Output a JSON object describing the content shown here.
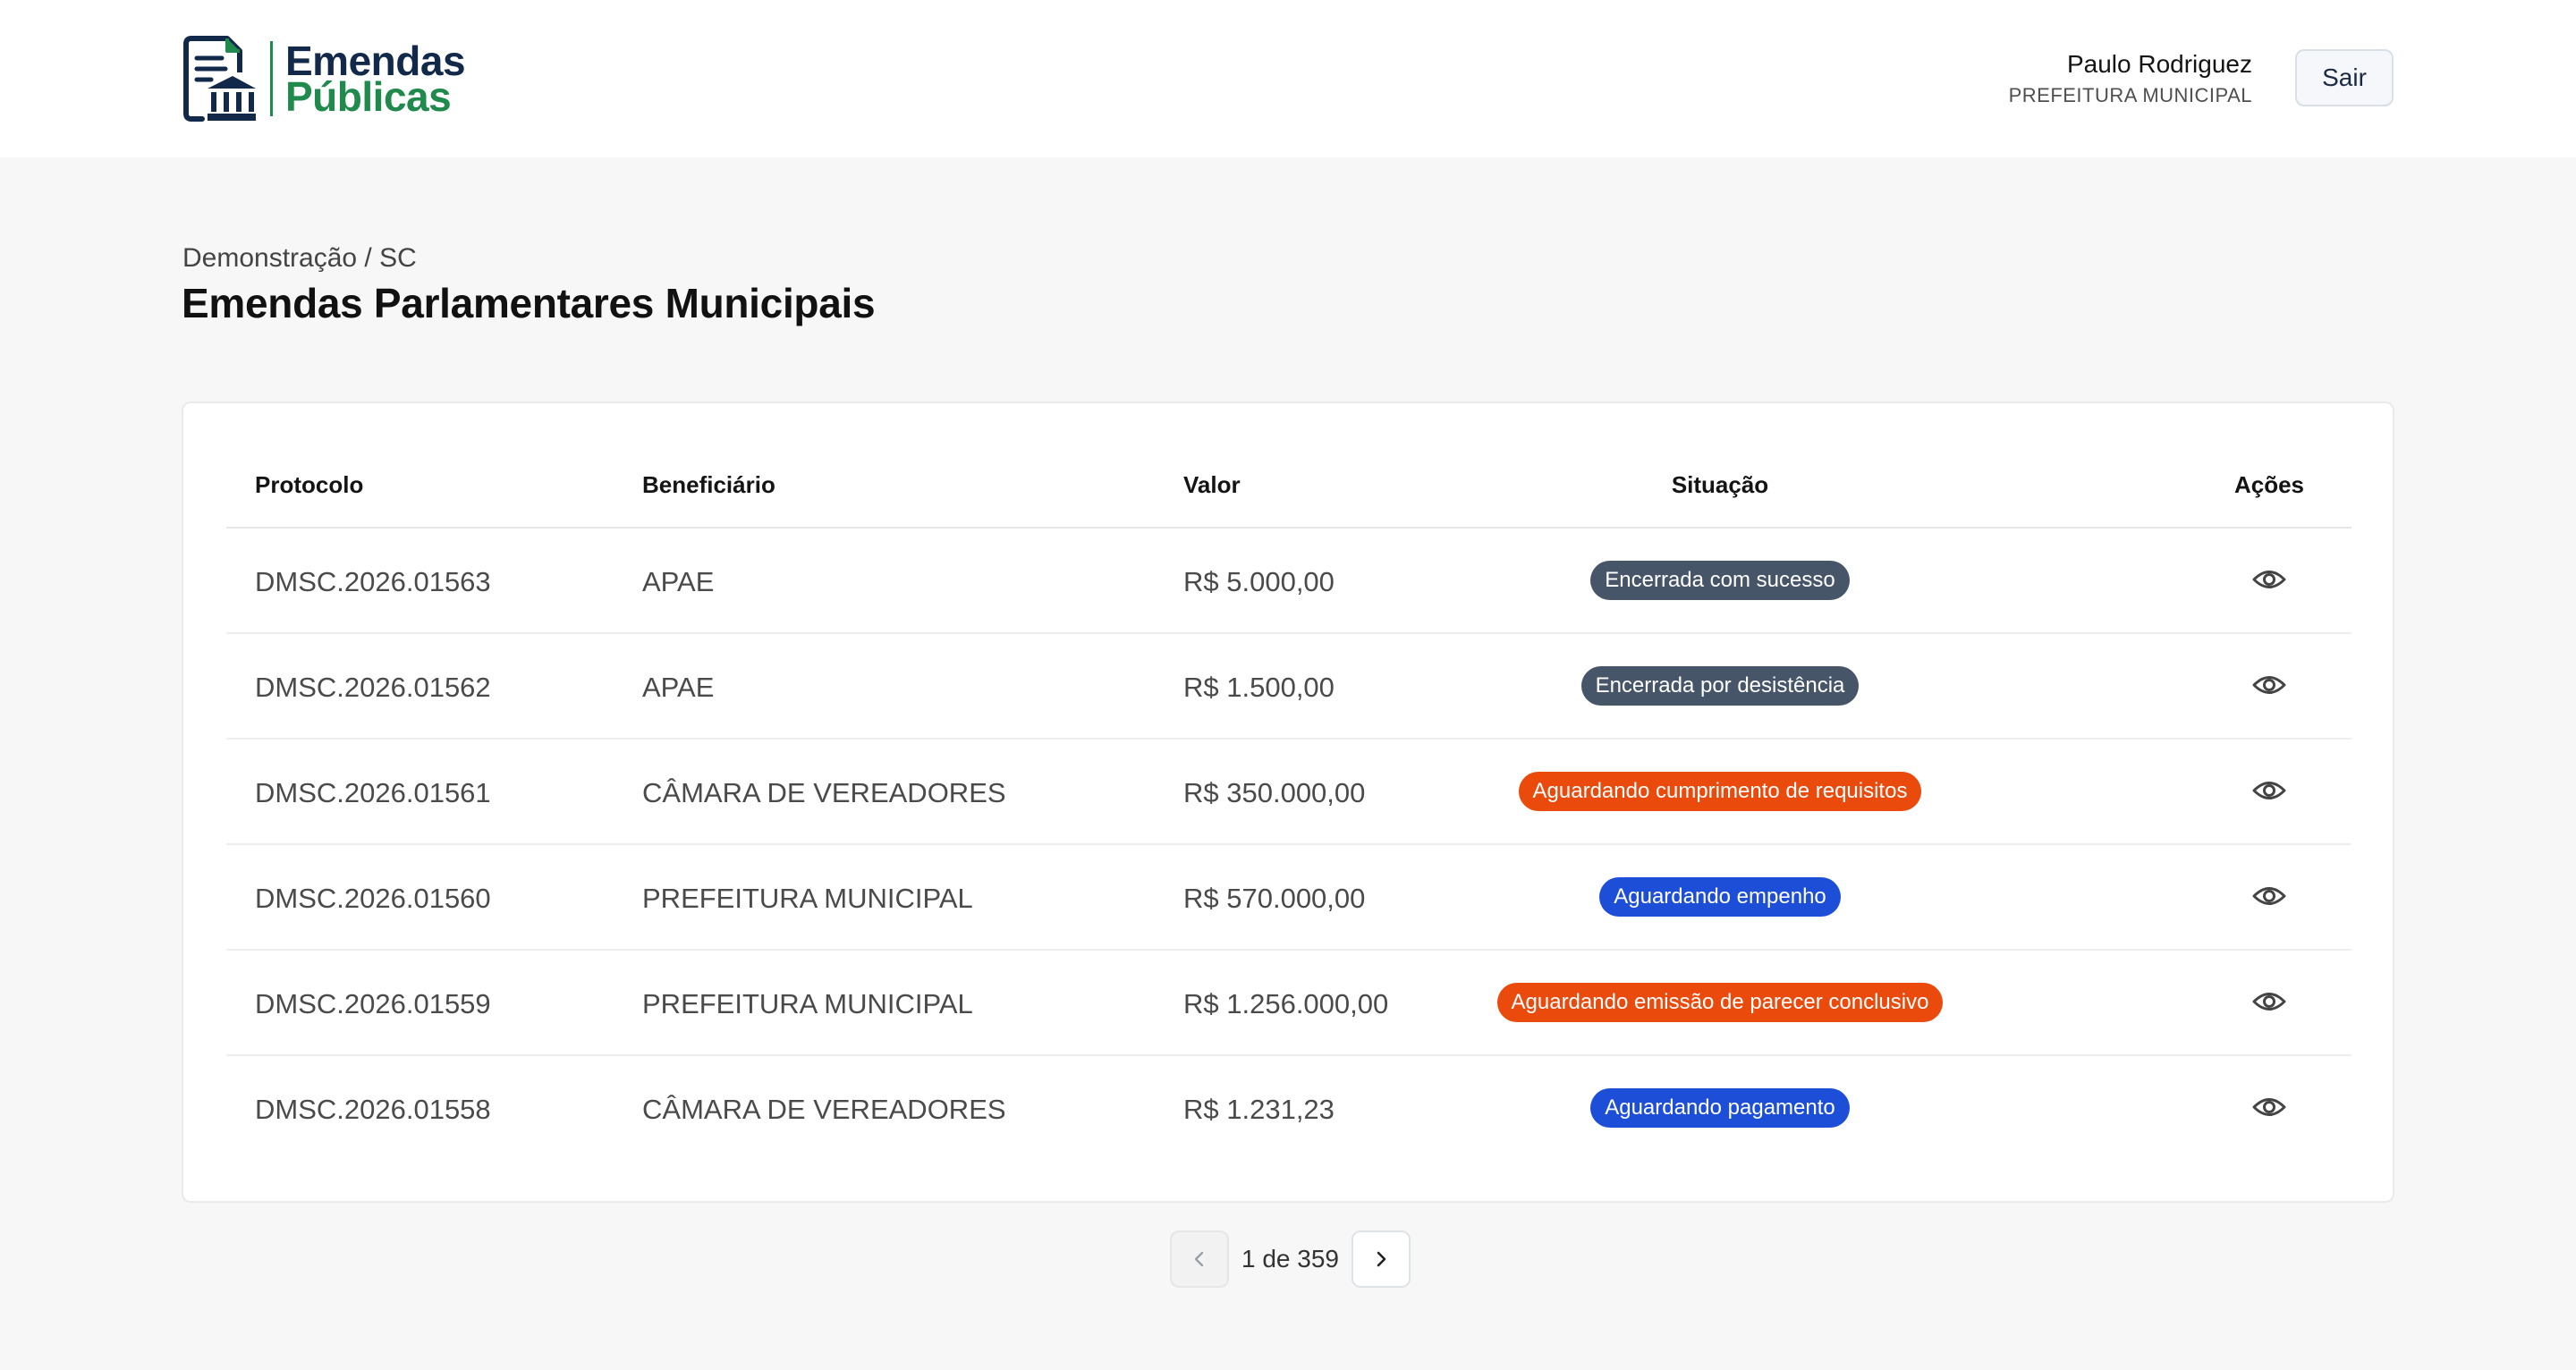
{
  "header": {
    "logo_line1": "Emendas",
    "logo_line2": "Públicas",
    "user_name": "Paulo Rodriguez",
    "user_org": "PREFEITURA MUNICIPAL",
    "logout_label": "Sair"
  },
  "page": {
    "breadcrumb": "Demonstração / SC",
    "title": "Emendas Parlamentares Municipais"
  },
  "table": {
    "columns": [
      "Protocolo",
      "Beneficiário",
      "Valor",
      "Situação",
      "Ações"
    ],
    "rows": [
      {
        "protocolo": "DMSC.2026.01563",
        "beneficiario": "APAE",
        "valor": "R$ 5.000,00",
        "situacao": "Encerrada com sucesso",
        "badge_color": "#475569"
      },
      {
        "protocolo": "DMSC.2026.01562",
        "beneficiario": "APAE",
        "valor": "R$ 1.500,00",
        "situacao": "Encerrada por desistência",
        "badge_color": "#475569"
      },
      {
        "protocolo": "DMSC.2026.01561",
        "beneficiario": "CÂMARA DE VEREADORES",
        "valor": "R$ 350.000,00",
        "situacao": "Aguardando cumprimento de requisitos",
        "badge_color": "#ea4a0c"
      },
      {
        "protocolo": "DMSC.2026.01560",
        "beneficiario": "PREFEITURA MUNICIPAL",
        "valor": "R$ 570.000,00",
        "situacao": "Aguardando empenho",
        "badge_color": "#1d4ed8"
      },
      {
        "protocolo": "DMSC.2026.01559",
        "beneficiario": "PREFEITURA MUNICIPAL",
        "valor": "R$ 1.256.000,00",
        "situacao": "Aguardando emissão de parecer conclusivo",
        "badge_color": "#ea4a0c"
      },
      {
        "protocolo": "DMSC.2026.01558",
        "beneficiario": "CÂMARA DE VEREADORES",
        "valor": "R$ 1.231,23",
        "situacao": "Aguardando pagamento",
        "badge_color": "#1d4ed8"
      }
    ]
  },
  "pagination": {
    "label": "1 de 359",
    "prev_icon": "chevron-left-icon",
    "next_icon": "chevron-right-icon"
  },
  "colors": {
    "brand_navy": "#12294a",
    "brand_green": "#1f8a4c",
    "status_gray": "#475569",
    "status_orange": "#ea4a0c",
    "status_blue": "#1d4ed8"
  }
}
